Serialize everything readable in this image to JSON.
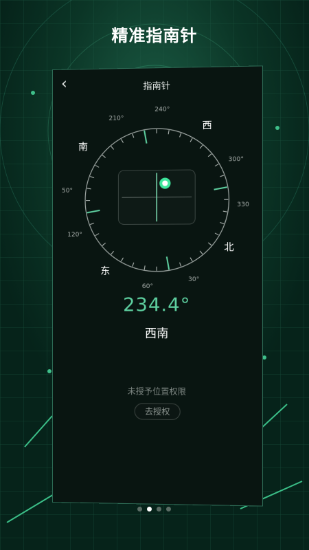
{
  "banner": {
    "title": "精准指南针"
  },
  "app": {
    "back_icon": "chevron-left-icon",
    "title": "指南针"
  },
  "compass": {
    "degree_labels": [
      "240°",
      "210°",
      "300°",
      "330",
      "120°",
      "50°",
      "60°",
      "30°"
    ],
    "cardinal_labels": [
      "西",
      "南",
      "北",
      "东"
    ],
    "heading": "234.4°",
    "direction": "西南",
    "accent": "#5ed0a0",
    "status_dot": "#3ee69c"
  },
  "permission": {
    "message": "未授予位置权限",
    "button_label": "去授权"
  },
  "pager": {
    "count": 4,
    "active": 1
  }
}
